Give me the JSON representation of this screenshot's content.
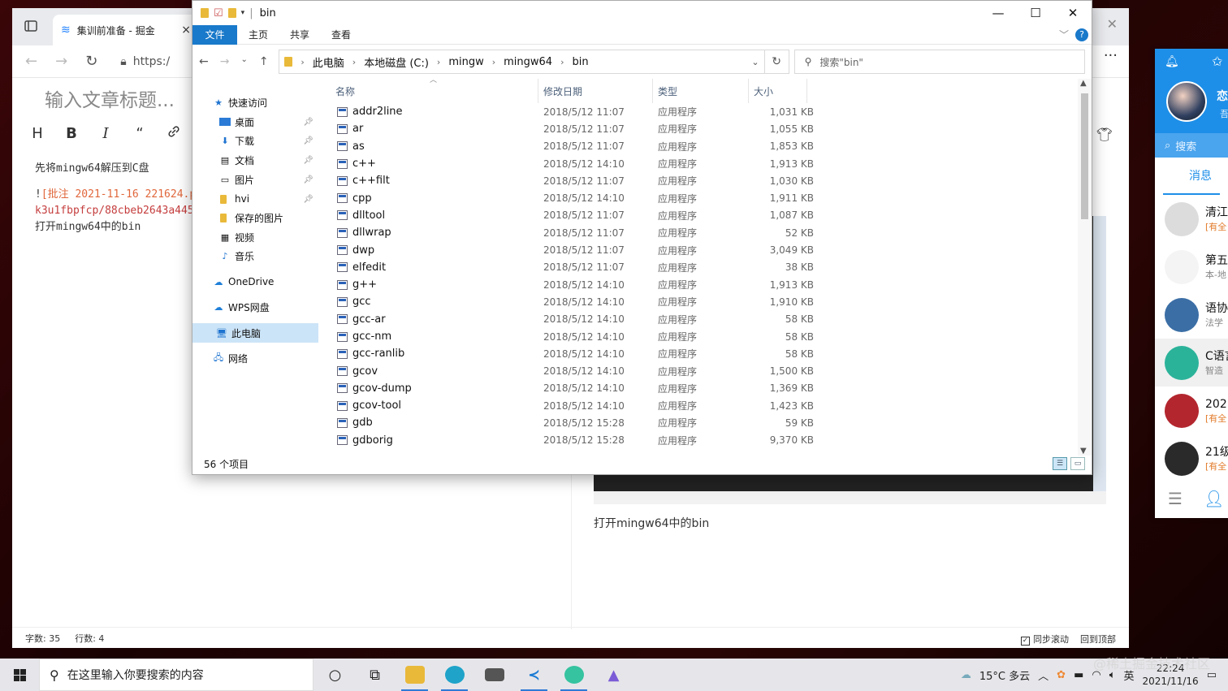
{
  "browser": {
    "tab_title": "集训前准备 - 掘金",
    "tab_close": "×",
    "address_prefix": "https:/",
    "more": "···",
    "window_close": "✕"
  },
  "editor": {
    "title_placeholder": "输入文章标题...",
    "toolbar": [
      "H",
      "B",
      "I",
      "“",
      "🔗",
      "▣"
    ],
    "lines": {
      "line1": "先将mingw64解压到C盘",
      "line2_prefix": "!",
      "line2_link": "[批注 2021-11-16 221624.p",
      "line3": "k3u1fbpfcp/88cbeb2643a445",
      "line4": "打开mingw64中的bin"
    },
    "preview_caption": "打开mingw64中的bin",
    "status": {
      "chars": "字数: 35",
      "lines": "行数: 4",
      "sync_scroll": "同步滚动",
      "back_top": "回到顶部"
    }
  },
  "explorer": {
    "window_title": "bin",
    "ribbon_tabs": {
      "file": "文件",
      "home": "主页",
      "share": "共享",
      "view": "查看"
    },
    "help": "?",
    "breadcrumb": [
      "此电脑",
      "本地磁盘 (C:)",
      "mingw",
      "mingw64",
      "bin"
    ],
    "search_placeholder": "搜索\"bin\"",
    "nav": {
      "quick_access": "快速访问",
      "desktop": "桌面",
      "downloads": "下载",
      "documents": "文档",
      "pictures": "图片",
      "hvi": "hvi",
      "saved_pictures": "保存的图片",
      "videos": "视频",
      "music": "音乐",
      "onedrive": "OneDrive",
      "wps": "WPS网盘",
      "this_pc": "此电脑",
      "network": "网络"
    },
    "columns": {
      "name": "名称",
      "date": "修改日期",
      "type": "类型",
      "size": "大小"
    },
    "files": [
      {
        "name": "addr2line",
        "date": "2018/5/12 11:07",
        "type": "应用程序",
        "size": "1,031 KB"
      },
      {
        "name": "ar",
        "date": "2018/5/12 11:07",
        "type": "应用程序",
        "size": "1,055 KB"
      },
      {
        "name": "as",
        "date": "2018/5/12 11:07",
        "type": "应用程序",
        "size": "1,853 KB"
      },
      {
        "name": "c++",
        "date": "2018/5/12 14:10",
        "type": "应用程序",
        "size": "1,913 KB"
      },
      {
        "name": "c++filt",
        "date": "2018/5/12 11:07",
        "type": "应用程序",
        "size": "1,030 KB"
      },
      {
        "name": "cpp",
        "date": "2018/5/12 14:10",
        "type": "应用程序",
        "size": "1,911 KB"
      },
      {
        "name": "dlltool",
        "date": "2018/5/12 11:07",
        "type": "应用程序",
        "size": "1,087 KB"
      },
      {
        "name": "dllwrap",
        "date": "2018/5/12 11:07",
        "type": "应用程序",
        "size": "52 KB"
      },
      {
        "name": "dwp",
        "date": "2018/5/12 11:07",
        "type": "应用程序",
        "size": "3,049 KB"
      },
      {
        "name": "elfedit",
        "date": "2018/5/12 11:07",
        "type": "应用程序",
        "size": "38 KB"
      },
      {
        "name": "g++",
        "date": "2018/5/12 14:10",
        "type": "应用程序",
        "size": "1,913 KB"
      },
      {
        "name": "gcc",
        "date": "2018/5/12 14:10",
        "type": "应用程序",
        "size": "1,910 KB"
      },
      {
        "name": "gcc-ar",
        "date": "2018/5/12 14:10",
        "type": "应用程序",
        "size": "58 KB"
      },
      {
        "name": "gcc-nm",
        "date": "2018/5/12 14:10",
        "type": "应用程序",
        "size": "58 KB"
      },
      {
        "name": "gcc-ranlib",
        "date": "2018/5/12 14:10",
        "type": "应用程序",
        "size": "58 KB"
      },
      {
        "name": "gcov",
        "date": "2018/5/12 14:10",
        "type": "应用程序",
        "size": "1,500 KB"
      },
      {
        "name": "gcov-dump",
        "date": "2018/5/12 14:10",
        "type": "应用程序",
        "size": "1,369 KB"
      },
      {
        "name": "gcov-tool",
        "date": "2018/5/12 14:10",
        "type": "应用程序",
        "size": "1,423 KB"
      },
      {
        "name": "gdb",
        "date": "2018/5/12 15:28",
        "type": "应用程序",
        "size": "59 KB"
      },
      {
        "name": "gdborig",
        "date": "2018/5/12 15:28",
        "type": "应用程序",
        "size": "9,370 KB"
      }
    ],
    "item_count": "56 个项目"
  },
  "chat": {
    "name_initial": "恋",
    "name_sub": "吾",
    "search": "搜索",
    "tab_messages": "消息",
    "items": [
      {
        "title": "清江",
        "sub": "[有全",
        "avatar_color": "#dcdcdc"
      },
      {
        "title": "第五",
        "sub": "本-地",
        "avatar_color": "#f4f4f4"
      },
      {
        "title": "语协",
        "sub": "法学",
        "avatar_color": "#3b6ea5"
      },
      {
        "title": "C语言",
        "sub": "智造",
        "avatar_color": "#2bb39a"
      },
      {
        "title": "202",
        "sub": "[有全",
        "avatar_color": "#b3262e"
      },
      {
        "title": "21级",
        "sub": "[有全",
        "avatar_color": "#2a2a2a"
      }
    ]
  },
  "taskbar": {
    "search_placeholder": "在这里输入你要搜索的内容",
    "weather": "15°C 多云",
    "ime": "英",
    "time": "22:24",
    "date": "2021/11/16"
  },
  "watermark": "@稀土掘金技术社区",
  "colors": {
    "accent": "#1979ca",
    "chat_blue": "#1e8fe8",
    "link": "#e0673b"
  }
}
